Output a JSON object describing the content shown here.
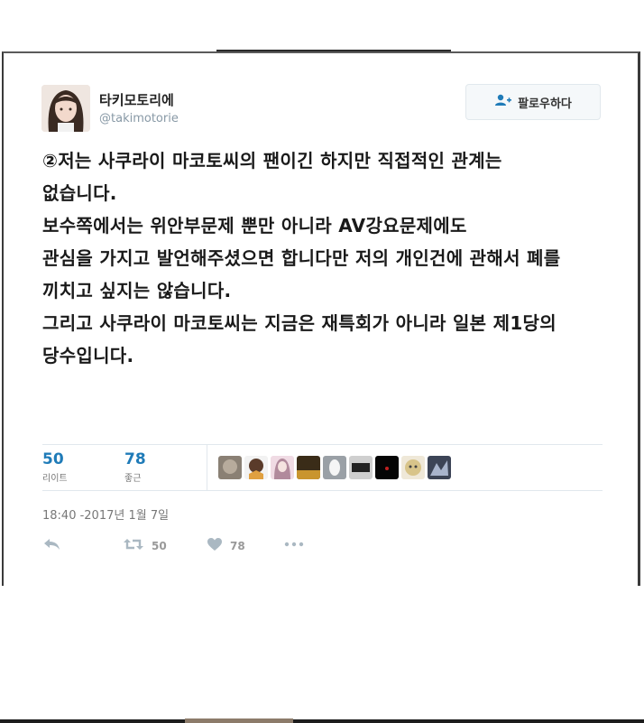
{
  "user": {
    "display_name": "타키모토리에",
    "handle": "@takimotorie"
  },
  "follow_button": {
    "label": "팔로우하다"
  },
  "tweet": {
    "lines": [
      "②저는 사쿠라이 마코토씨의 팬이긴 하지만 직접적인 관계는",
      "없습니다.",
      "보수쪽에서는 위안부문제 뿐만 아니라 AV강요문제에도",
      "관심을 가지고 발언해주셨으면 합니다만 저의 개인건에 관해서 폐를",
      "끼치고 싶지는 않습니다.",
      "그리고 사쿠라이 마코토씨는 지금은 재특회가 아니라 일본 제1당의",
      "당수입니다."
    ]
  },
  "stats": {
    "retweets": {
      "count": "50",
      "label": "리이트"
    },
    "likes": {
      "count": "78",
      "label": "좋근"
    }
  },
  "timestamp": "18:40 -2017년 1월 7일",
  "actions": {
    "retweet_count": "50",
    "like_count": "78"
  },
  "colors": {
    "accent": "#1f7bb8",
    "muted": "#8899a6"
  }
}
